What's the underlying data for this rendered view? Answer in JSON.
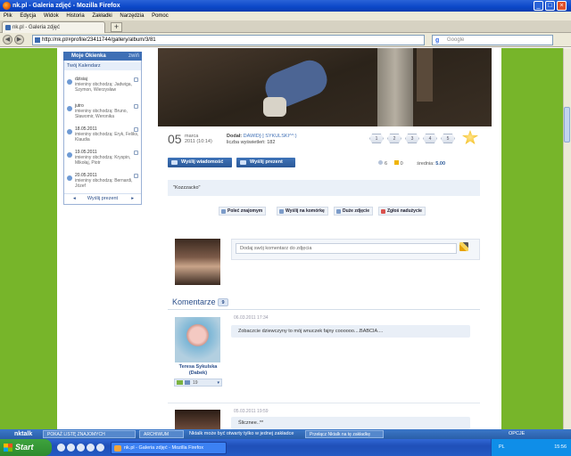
{
  "window": {
    "title": "nk.pl - Galeria zdjęć - Mozilla Firefox"
  },
  "menu": [
    "Plik",
    "Edycja",
    "Widok",
    "Historia",
    "Zakładki",
    "Narzędzia",
    "Pomoc"
  ],
  "tab": {
    "label": "nk.pl - Galeria zdjęć",
    "new": "+"
  },
  "nav": {
    "url": "http://nk.pl/#profile/23411744/gallery/album/3/81",
    "search_placeholder": "Google"
  },
  "widget": {
    "title": "Moje Okienka",
    "close": "zwiń",
    "subtitle": "Twój Kalendarz",
    "events": [
      {
        "date": "dzisiaj",
        "text": "imieniny obchodzą: Jadwiga, Szymon, Wierzysław"
      },
      {
        "date": "jutro",
        "text": "imieniny obchodzą: Bruno, Sławomir, Weronika"
      },
      {
        "date": "18.05.2011",
        "text": "imieniny obchodzą: Eryk, Feliks, Klaudia"
      },
      {
        "date": "19.05.2011",
        "text": "imieniny obchodzą: Kryspin, Mikołaj, Piotr"
      },
      {
        "date": "20.05.2011",
        "text": "imieniny obchodzą: Bernardi, Józef"
      }
    ],
    "footer": "Wyślij prezent"
  },
  "photo": {
    "day": "05",
    "month": "marca",
    "year_time": "2011 (10:14)",
    "added_label": "Dodał:",
    "author": "DAWID[-] SYKULSKI^^:)",
    "views": "liczba wyświetleń: 182",
    "ratings": [
      "1",
      "2",
      "3",
      "4",
      "5"
    ],
    "send_message": "Wyślij wiadomość",
    "send_gift": "Wyślij prezent",
    "hearts": "6",
    "stars": "0",
    "avg_label": "średnia:",
    "avg": "5.00",
    "description": "\"Kozzzacko\"",
    "actions": [
      "Poleć znajomym",
      "Wyślij na komórkę",
      "Duże zdjęcie",
      "Zgłoś nadużycie"
    ]
  },
  "add_comment": {
    "placeholder": "Dodaj swój komentarz do zdjęcia"
  },
  "comments": {
    "title": "Komentarze",
    "count": "9",
    "items": [
      {
        "author": "Teresa Sykulska (Dabek)",
        "date": "06.03.2011 17:34",
        "text": "Zobaczcie dziewczyny to mój wnuczek fajny coooooo....BABCIA....",
        "gifts": "19"
      },
      {
        "author": "",
        "date": "05.03.2011 19:59",
        "text": "Ślicznee..**"
      }
    ]
  },
  "nkbar": {
    "logo": "nktalk",
    "invite": "POKAŻ LISTĘ ZNAJOMYCH",
    "archive": "ARCHIWUM",
    "notice1": "Nktalk może być otwarty tylko w jednej zakładce",
    "notice2": "Przełącz Nktalk na tę zakładkę",
    "options": "OPCJE"
  },
  "taskbar": {
    "start": "Start",
    "task": "nk.pl - Galeria zdjęć - Mozilla Firefox",
    "lang": "PL",
    "clock": "15:56"
  },
  "colors": {
    "page_bg": "#77b52a",
    "accent": "#3e6fb5",
    "titlebar": "#0b47c8"
  }
}
